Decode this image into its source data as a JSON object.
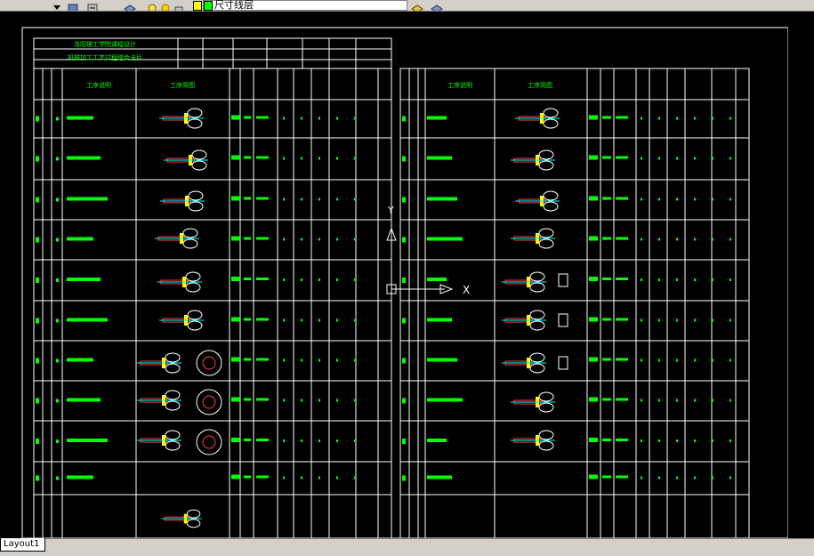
{
  "window": {
    "layer_name": "尺寸线层",
    "layout_tab": "Layout1"
  },
  "colors": {
    "background": "#000000",
    "linework": "#ffffff",
    "text_green": "#00ff00",
    "ucs_icon": "#ffffff",
    "toolbar": "#d4d0c8"
  },
  "sheet": {
    "title_school": "洛阳理工学院课程设计",
    "title_card": "机械加工工艺过程综合卡片",
    "left_headers": {
      "description": "工序说明",
      "sketch": "工序简图"
    },
    "right_headers": {
      "description": "工序说明",
      "sketch": "工序简图"
    }
  },
  "icons": [
    "layer-manager-icon",
    "layer-previous-icon",
    "lightbulb-icon",
    "sun-icon",
    "lock-icon",
    "color-swatch-icon",
    "layer-match-icon",
    "layer-stack-icon"
  ]
}
